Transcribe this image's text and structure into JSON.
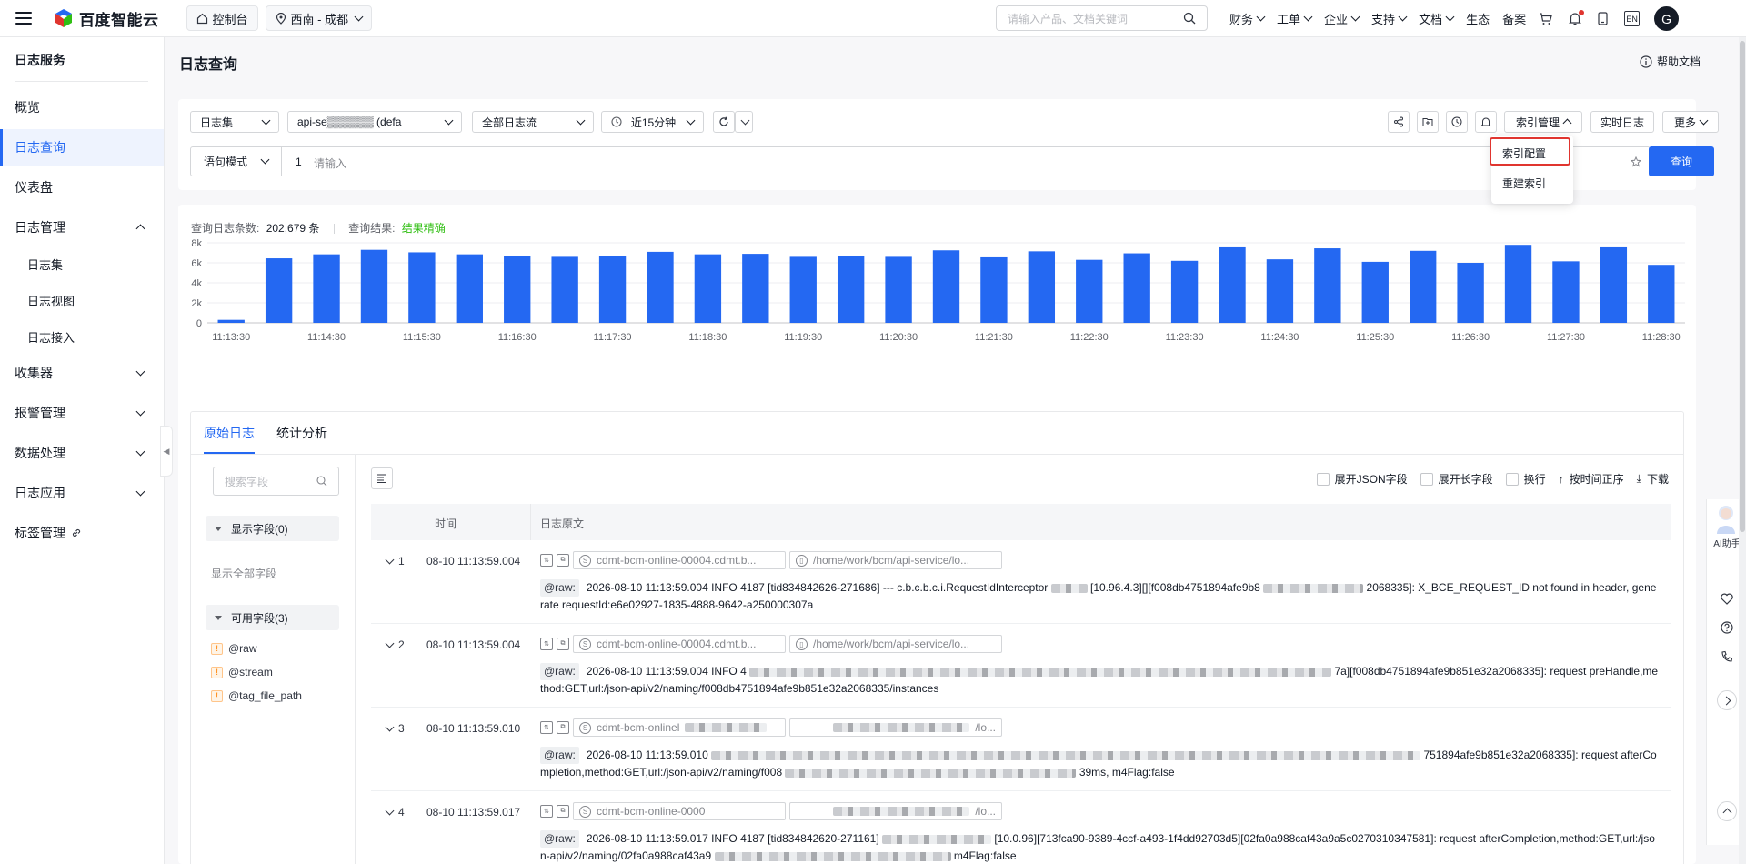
{
  "topbar": {
    "brand": "百度智能云",
    "console": "控制台",
    "region": "西南 - 成都",
    "search_placeholder": "请输入产品、文档关键词",
    "nav": [
      {
        "label": "财务",
        "has_menu": true
      },
      {
        "label": "工单",
        "has_menu": true
      },
      {
        "label": "企业",
        "has_menu": true
      },
      {
        "label": "支持",
        "has_menu": true
      },
      {
        "label": "文档",
        "has_menu": true
      },
      {
        "label": "生态",
        "has_menu": false
      },
      {
        "label": "备案",
        "has_menu": false
      }
    ],
    "lang": "EN",
    "avatar": "G",
    "icons": [
      "cart-icon",
      "bell-icon",
      "phone-icon"
    ],
    "accent": "#2468f2"
  },
  "sidebar": {
    "title": "日志服务",
    "items": [
      {
        "label": "概览"
      },
      {
        "label": "日志查询",
        "active": true
      },
      {
        "label": "仪表盘"
      },
      {
        "label": "日志管理",
        "expanded": true
      },
      {
        "label": "日志集",
        "sub": true
      },
      {
        "label": "日志视图",
        "sub": true
      },
      {
        "label": "日志接入",
        "sub": true
      },
      {
        "label": "收集器"
      },
      {
        "label": "报警管理"
      },
      {
        "label": "数据处理"
      },
      {
        "label": "日志应用"
      },
      {
        "label": "标签管理"
      }
    ]
  },
  "page": {
    "title": "日志查询",
    "help": "帮助文档"
  },
  "toolbar": {
    "logset": "日志集",
    "logstore": "api-se▒▒▒▒▒▒ (defa",
    "stream": "全部日志流",
    "time": "近15分钟",
    "index_mgmt": "索引管理",
    "realtime": "实时日志",
    "more": "更多",
    "query_mode": "语句模式",
    "line_no": "1",
    "query_placeholder": "请输入",
    "query_btn": "查询",
    "dropdown": [
      "索引配置",
      "重建索引"
    ]
  },
  "stats": {
    "count_label": "查询日志条数:",
    "count_value": "202,679 条",
    "result_label": "查询结果:",
    "result_value": "结果精确",
    "result_color": "#30bf13"
  },
  "chart_data": {
    "type": "bar",
    "title": "",
    "xlabel": "",
    "ylabel": "",
    "ylim": [
      0,
      8000
    ],
    "y_ticks": [
      "0",
      "2k",
      "4k",
      "6k",
      "8k"
    ],
    "x_ticks": [
      "11:13:30",
      "11:14:30",
      "11:15:30",
      "11:16:30",
      "11:17:30",
      "11:18:30",
      "11:19:30",
      "11:20:30",
      "11:21:30",
      "11:22:30",
      "11:23:30",
      "11:24:30",
      "11:25:30",
      "11:26:30",
      "11:27:30",
      "11:28:30"
    ],
    "values": [
      300,
      6450,
      6850,
      7300,
      7050,
      6850,
      6700,
      6600,
      6700,
      7100,
      6850,
      6900,
      6600,
      6700,
      6600,
      7250,
      6550,
      7150,
      6300,
      6950,
      6200,
      7550,
      6350,
      7450,
      6100,
      7200,
      6000,
      7800,
      6150,
      7550,
      5800
    ],
    "color": "#2468f2",
    "grid": true
  },
  "tabs": [
    "原始日志",
    "统计分析"
  ],
  "fields": {
    "search_placeholder": "搜索字段",
    "shown_group": "显示字段(0)",
    "show_all": "显示全部字段",
    "available_group": "可用字段(3)",
    "available": [
      "@raw",
      "@stream",
      "@tag_file_path"
    ]
  },
  "logopts": {
    "expand_json": "展开JSON字段",
    "expand_long": "展开长字段",
    "wrap": "换行",
    "sort": "按时间正序",
    "download": "下载"
  },
  "table": {
    "col_time": "时间",
    "col_raw": "日志原文",
    "raw_label": "@raw:",
    "rows": [
      {
        "n": "1",
        "time": "08-10 11:13:59.004",
        "host": "cdmt-bcm-online-00004.cdmt.b...",
        "path": "/home/work/bcm/api-service/lo...",
        "raw_a": "2026-08-10 11:13:59.004 INFO 4187 [tid834842626-271686] --- c.b.c.b.c.i.RequestIdInterceptor",
        "raw_b": "[10.96.4.3][][f008db4751894afe9b8",
        "raw_c": "2068335]: X_BCE_REQUEST_ID not found in header, generate requestId:e6e02927-1835-4888-9642-a250000307a"
      },
      {
        "n": "2",
        "time": "08-10 11:13:59.004",
        "host": "cdmt-bcm-online-00004.cdmt.b...",
        "path": "/home/work/bcm/api-service/lo...",
        "raw_a": "2026-08-10 11:13:59.004 INFO 4",
        "raw_b": "",
        "raw_c": "7a][f008db4751894afe9b851e32a2068335]: request preHandle,method:GET,url:/json-api/v2/naming/f008db4751894afe9b851e32a2068335/instances"
      },
      {
        "n": "3",
        "time": "08-10 11:13:59.010",
        "host": "cdmt-bcm-onlinel",
        "path": "/lo...",
        "raw_a": "2026-08-10 11:13:59.010",
        "raw_b": "",
        "raw_c": "751894afe9b851e32a2068335]: request afterCompletion,method:GET,url:/json-api/v2/naming/f008",
        "raw_d": "39ms, m4Flag:false"
      },
      {
        "n": "4",
        "time": "08-10 11:13:59.017",
        "host": "cdmt-bcm-online-0000",
        "path": "/lo...",
        "raw_a": "2026-08-10 11:13:59.017 INFO 4187 [tid834842620-271161]",
        "raw_b": "[10.0.96][713fca90-9389-4ccf-a493-1f4dd92703d5][02fa0a988caf43a9a5c0270310347581]: request afterCompletion,method:GET,url:/json-api/v2/naming/02fa0a988caf43a9",
        "raw_c": "m4Flag:false"
      }
    ]
  },
  "rightbar": {
    "ai_label": "AI助手"
  }
}
